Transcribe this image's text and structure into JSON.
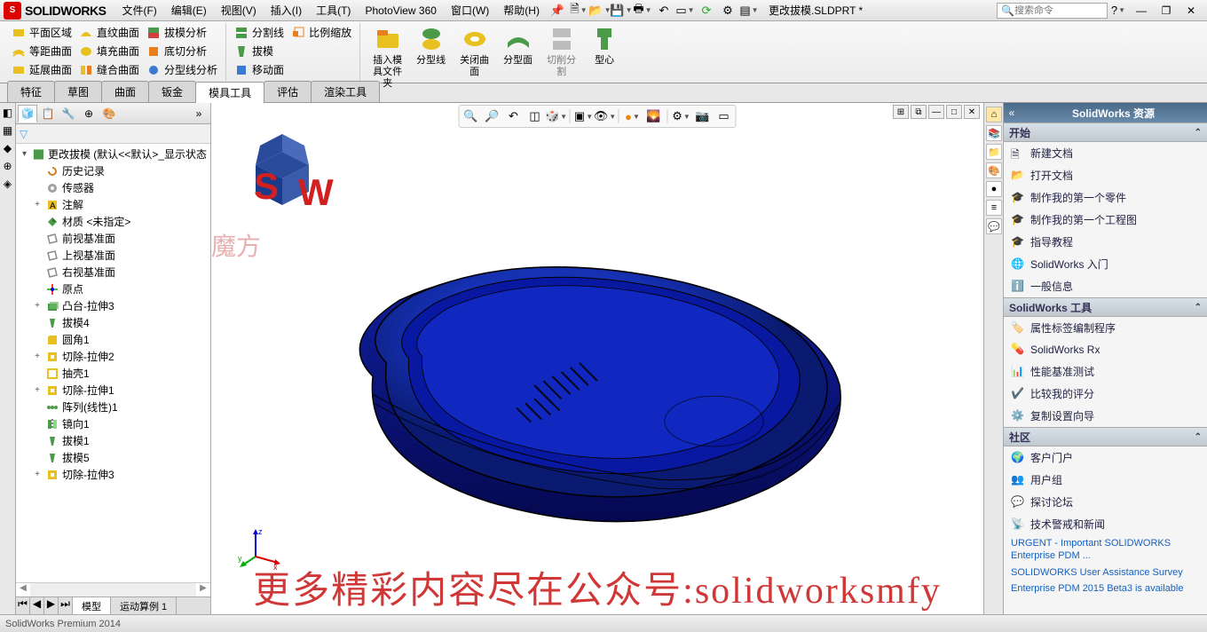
{
  "app_name": "SOLIDWORKS",
  "menus": [
    "文件(F)",
    "编辑(E)",
    "视图(V)",
    "插入(I)",
    "工具(T)",
    "PhotoView 360",
    "窗口(W)",
    "帮助(H)"
  ],
  "doc_name": "更改拔模.SLDPRT *",
  "search_placeholder": "搜索命令",
  "ribbon": {
    "g1": {
      "r1": [
        "平面区域",
        "直纹曲面",
        "拔模分析"
      ],
      "r2": [
        "等距曲面",
        "填充曲面",
        "底切分析"
      ],
      "r3": [
        "延展曲面",
        "缝合曲面",
        "分型线分析"
      ]
    },
    "g2": {
      "r1": [
        "分割线",
        "比例缩放"
      ],
      "r2": [
        "拔模"
      ],
      "r3": [
        "移动面"
      ]
    },
    "big": [
      "插入模\n具文件\n夹",
      "分型线",
      "关闭曲\n面",
      "分型面",
      "切削分\n割",
      "型心"
    ]
  },
  "cmd_tabs": [
    "特征",
    "草图",
    "曲面",
    "钣金",
    "模具工具",
    "评估",
    "渲染工具"
  ],
  "cmd_tab_active": 4,
  "tree": {
    "root": "更改拔模 (默认<<默认>_显示状态",
    "items": [
      {
        "icon": "history",
        "label": "历史记录",
        "indent": 1,
        "twisty": ""
      },
      {
        "icon": "sensor",
        "label": "传感器",
        "indent": 1,
        "twisty": ""
      },
      {
        "icon": "annot",
        "label": "注解",
        "indent": 1,
        "twisty": "+"
      },
      {
        "icon": "material",
        "label": "材质 <未指定>",
        "indent": 1,
        "twisty": ""
      },
      {
        "icon": "plane",
        "label": "前视基准面",
        "indent": 1,
        "twisty": ""
      },
      {
        "icon": "plane",
        "label": "上视基准面",
        "indent": 1,
        "twisty": ""
      },
      {
        "icon": "plane",
        "label": "右视基准面",
        "indent": 1,
        "twisty": ""
      },
      {
        "icon": "origin",
        "label": "原点",
        "indent": 1,
        "twisty": ""
      },
      {
        "icon": "extrude",
        "label": "凸台-拉伸3",
        "indent": 1,
        "twisty": "+"
      },
      {
        "icon": "draft",
        "label": "拔模4",
        "indent": 1,
        "twisty": ""
      },
      {
        "icon": "fillet",
        "label": "圆角1",
        "indent": 1,
        "twisty": ""
      },
      {
        "icon": "cut",
        "label": "切除-拉伸2",
        "indent": 1,
        "twisty": "+"
      },
      {
        "icon": "shell",
        "label": "抽壳1",
        "indent": 1,
        "twisty": ""
      },
      {
        "icon": "cut",
        "label": "切除-拉伸1",
        "indent": 1,
        "twisty": "+"
      },
      {
        "icon": "pattern",
        "label": "阵列(线性)1",
        "indent": 1,
        "twisty": ""
      },
      {
        "icon": "mirror",
        "label": "镜向1",
        "indent": 1,
        "twisty": ""
      },
      {
        "icon": "draft",
        "label": "拔模1",
        "indent": 1,
        "twisty": ""
      },
      {
        "icon": "draft",
        "label": "拔模5",
        "indent": 1,
        "twisty": ""
      },
      {
        "icon": "cut",
        "label": "切除-拉伸3",
        "indent": 1,
        "twisty": "+"
      }
    ]
  },
  "bottom_tabs": [
    "模型",
    "运动算例 1"
  ],
  "watermark": "魔方",
  "banner": "更多精彩内容尽在公众号:solidworksmfy",
  "taskpane": {
    "title": "SolidWorks 资源",
    "sections": [
      {
        "head": "开始",
        "items": [
          {
            "icon": "newdoc",
            "label": "新建文档"
          },
          {
            "icon": "opendoc",
            "label": "打开文档"
          },
          {
            "icon": "grad",
            "label": "制作我的第一个零件"
          },
          {
            "icon": "grad",
            "label": "制作我的第一个工程图"
          },
          {
            "icon": "grad",
            "label": "指导教程"
          },
          {
            "icon": "swglobe",
            "label": "SolidWorks 入门"
          },
          {
            "icon": "info",
            "label": "一般信息"
          }
        ]
      },
      {
        "head": "SolidWorks 工具",
        "items": [
          {
            "icon": "prop",
            "label": "属性标签编制程序"
          },
          {
            "icon": "rx",
            "label": "SolidWorks Rx"
          },
          {
            "icon": "bench",
            "label": "性能基准测试"
          },
          {
            "icon": "compare",
            "label": "比较我的评分"
          },
          {
            "icon": "copy",
            "label": "复制设置向导"
          }
        ]
      },
      {
        "head": "社区",
        "items": [
          {
            "icon": "portal",
            "label": "客户门户"
          },
          {
            "icon": "users",
            "label": "用户组"
          },
          {
            "icon": "forum",
            "label": "探讨论坛"
          },
          {
            "icon": "rss",
            "label": "技术警戒和新闻"
          }
        ]
      }
    ],
    "news": [
      "URGENT - Important SOLIDWORKS Enterprise PDM ...",
      "SOLIDWORKS User Assistance Survey",
      "Enterprise PDM 2015 Beta3 is available"
    ]
  },
  "status": "SolidWorks Premium 2014"
}
